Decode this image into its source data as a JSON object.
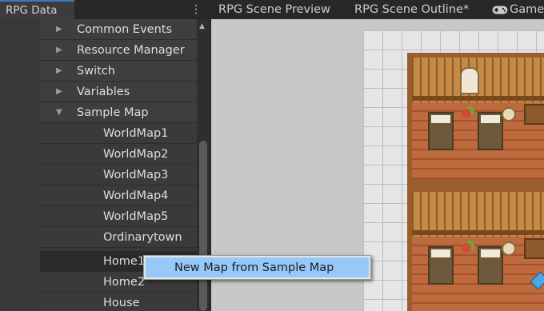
{
  "left_panel": {
    "tab_title": "RPG Data",
    "tree": [
      {
        "label": "Common Events",
        "expanded": false,
        "level": 0
      },
      {
        "label": "Resource Manager",
        "expanded": false,
        "level": 0
      },
      {
        "label": "Switch",
        "expanded": false,
        "level": 0
      },
      {
        "label": "Variables",
        "expanded": false,
        "level": 0
      },
      {
        "label": "Sample Map",
        "expanded": true,
        "level": 0
      },
      {
        "label": "WorldMap1",
        "level": 1
      },
      {
        "label": "WorldMap2",
        "level": 1
      },
      {
        "label": "WorldMap3",
        "level": 1
      },
      {
        "label": "WorldMap4",
        "level": 1
      },
      {
        "label": "WorldMap5",
        "level": 1
      },
      {
        "label": "Ordinarytown",
        "level": 1
      },
      {
        "label": "Home1",
        "level": 1,
        "hovered": true
      },
      {
        "label": "Home2",
        "level": 1
      },
      {
        "label": "House",
        "level": 1
      }
    ]
  },
  "right_tabs": [
    {
      "label": "RPG Scene Preview"
    },
    {
      "label": "RPG Scene Outline*"
    },
    {
      "label": "Game",
      "icon": "gamepad-icon"
    }
  ],
  "context_menu": {
    "items": [
      {
        "label": "New Map from Sample Map",
        "highlighted": true
      }
    ]
  },
  "colors": {
    "accent": "#3a79bb",
    "panel_bg": "#383838",
    "menu_highlight": "#96c8fa"
  }
}
